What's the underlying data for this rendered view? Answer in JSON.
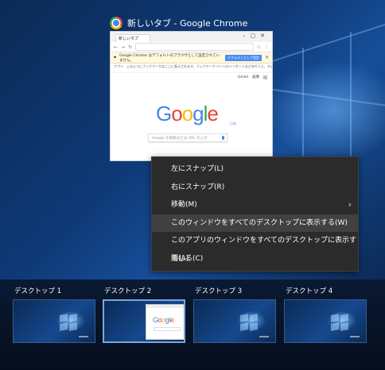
{
  "window": {
    "title": "新しいタブ - Google Chrome",
    "tab_label": "新しいタブ",
    "infobar_text": "Google Chrome はデフォルトのブラウザとして設定されていません。",
    "infobar_button": "デフォルトとして設定",
    "bookmark_text": "アプリ　このようにブックマークはここに表示されます。ブックマーク バーへのインポートなどを行うと、すばやくアクセスできます。",
    "header_links": [
      "Gmail",
      "画像"
    ],
    "google_sub": "日本",
    "search_placeholder": "Google を検索または URL を入力"
  },
  "context_menu": {
    "items": [
      {
        "label": "左にスナップ(L)",
        "has_submenu": false,
        "highlighted": false
      },
      {
        "label": "右にスナップ(R)",
        "has_submenu": false,
        "highlighted": false
      },
      {
        "label": "移動(M)",
        "has_submenu": true,
        "highlighted": false
      },
      {
        "label": "このウィンドウをすべてのデスクトップに表示する(W)",
        "has_submenu": false,
        "highlighted": true
      },
      {
        "label": "このアプリのウィンドウをすべてのデスクトップに表示する(A)",
        "has_submenu": false,
        "highlighted": false
      },
      {
        "label": "閉じる(C)",
        "has_submenu": false,
        "highlighted": false
      }
    ]
  },
  "desktops": [
    {
      "label": "デスクトップ 1",
      "active": false
    },
    {
      "label": "デスクトップ 2",
      "active": true
    },
    {
      "label": "デスクトップ 3",
      "active": false
    },
    {
      "label": "デスクトップ 4",
      "active": false
    }
  ],
  "colors": {
    "menu_bg": "#2b2b2b",
    "menu_highlight": "#414141",
    "active_border": "#7ba6dc"
  }
}
